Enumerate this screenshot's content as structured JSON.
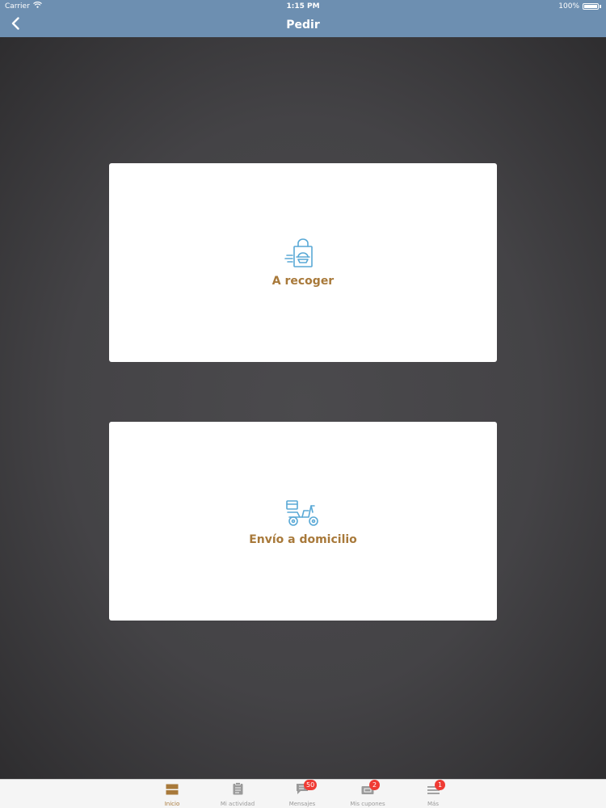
{
  "status": {
    "carrier": "Carrier",
    "time": "1:15 PM",
    "battery": "100%"
  },
  "nav": {
    "title": "Pedir",
    "back_icon": "chevron-left-icon"
  },
  "options": [
    {
      "label": "A recoger",
      "icon": "pickup-bag-icon"
    },
    {
      "label": "Envío a domicilio",
      "icon": "delivery-scooter-icon"
    }
  ],
  "tabs": [
    {
      "label": "Inicio",
      "icon": "home-icon",
      "active": true
    },
    {
      "label": "Mi actividad",
      "icon": "clipboard-icon"
    },
    {
      "label": "Mensajes",
      "icon": "chat-icon",
      "badge": "50"
    },
    {
      "label": "Mis cupones",
      "icon": "coupon-icon",
      "badge": "2"
    },
    {
      "label": "Más",
      "icon": "menu-icon",
      "badge": "1"
    }
  ],
  "colors": {
    "nav_bg": "#6d8fb1",
    "accent": "#a8793a",
    "icon_blue": "#5aa9d6",
    "badge": "#ef3b34"
  }
}
